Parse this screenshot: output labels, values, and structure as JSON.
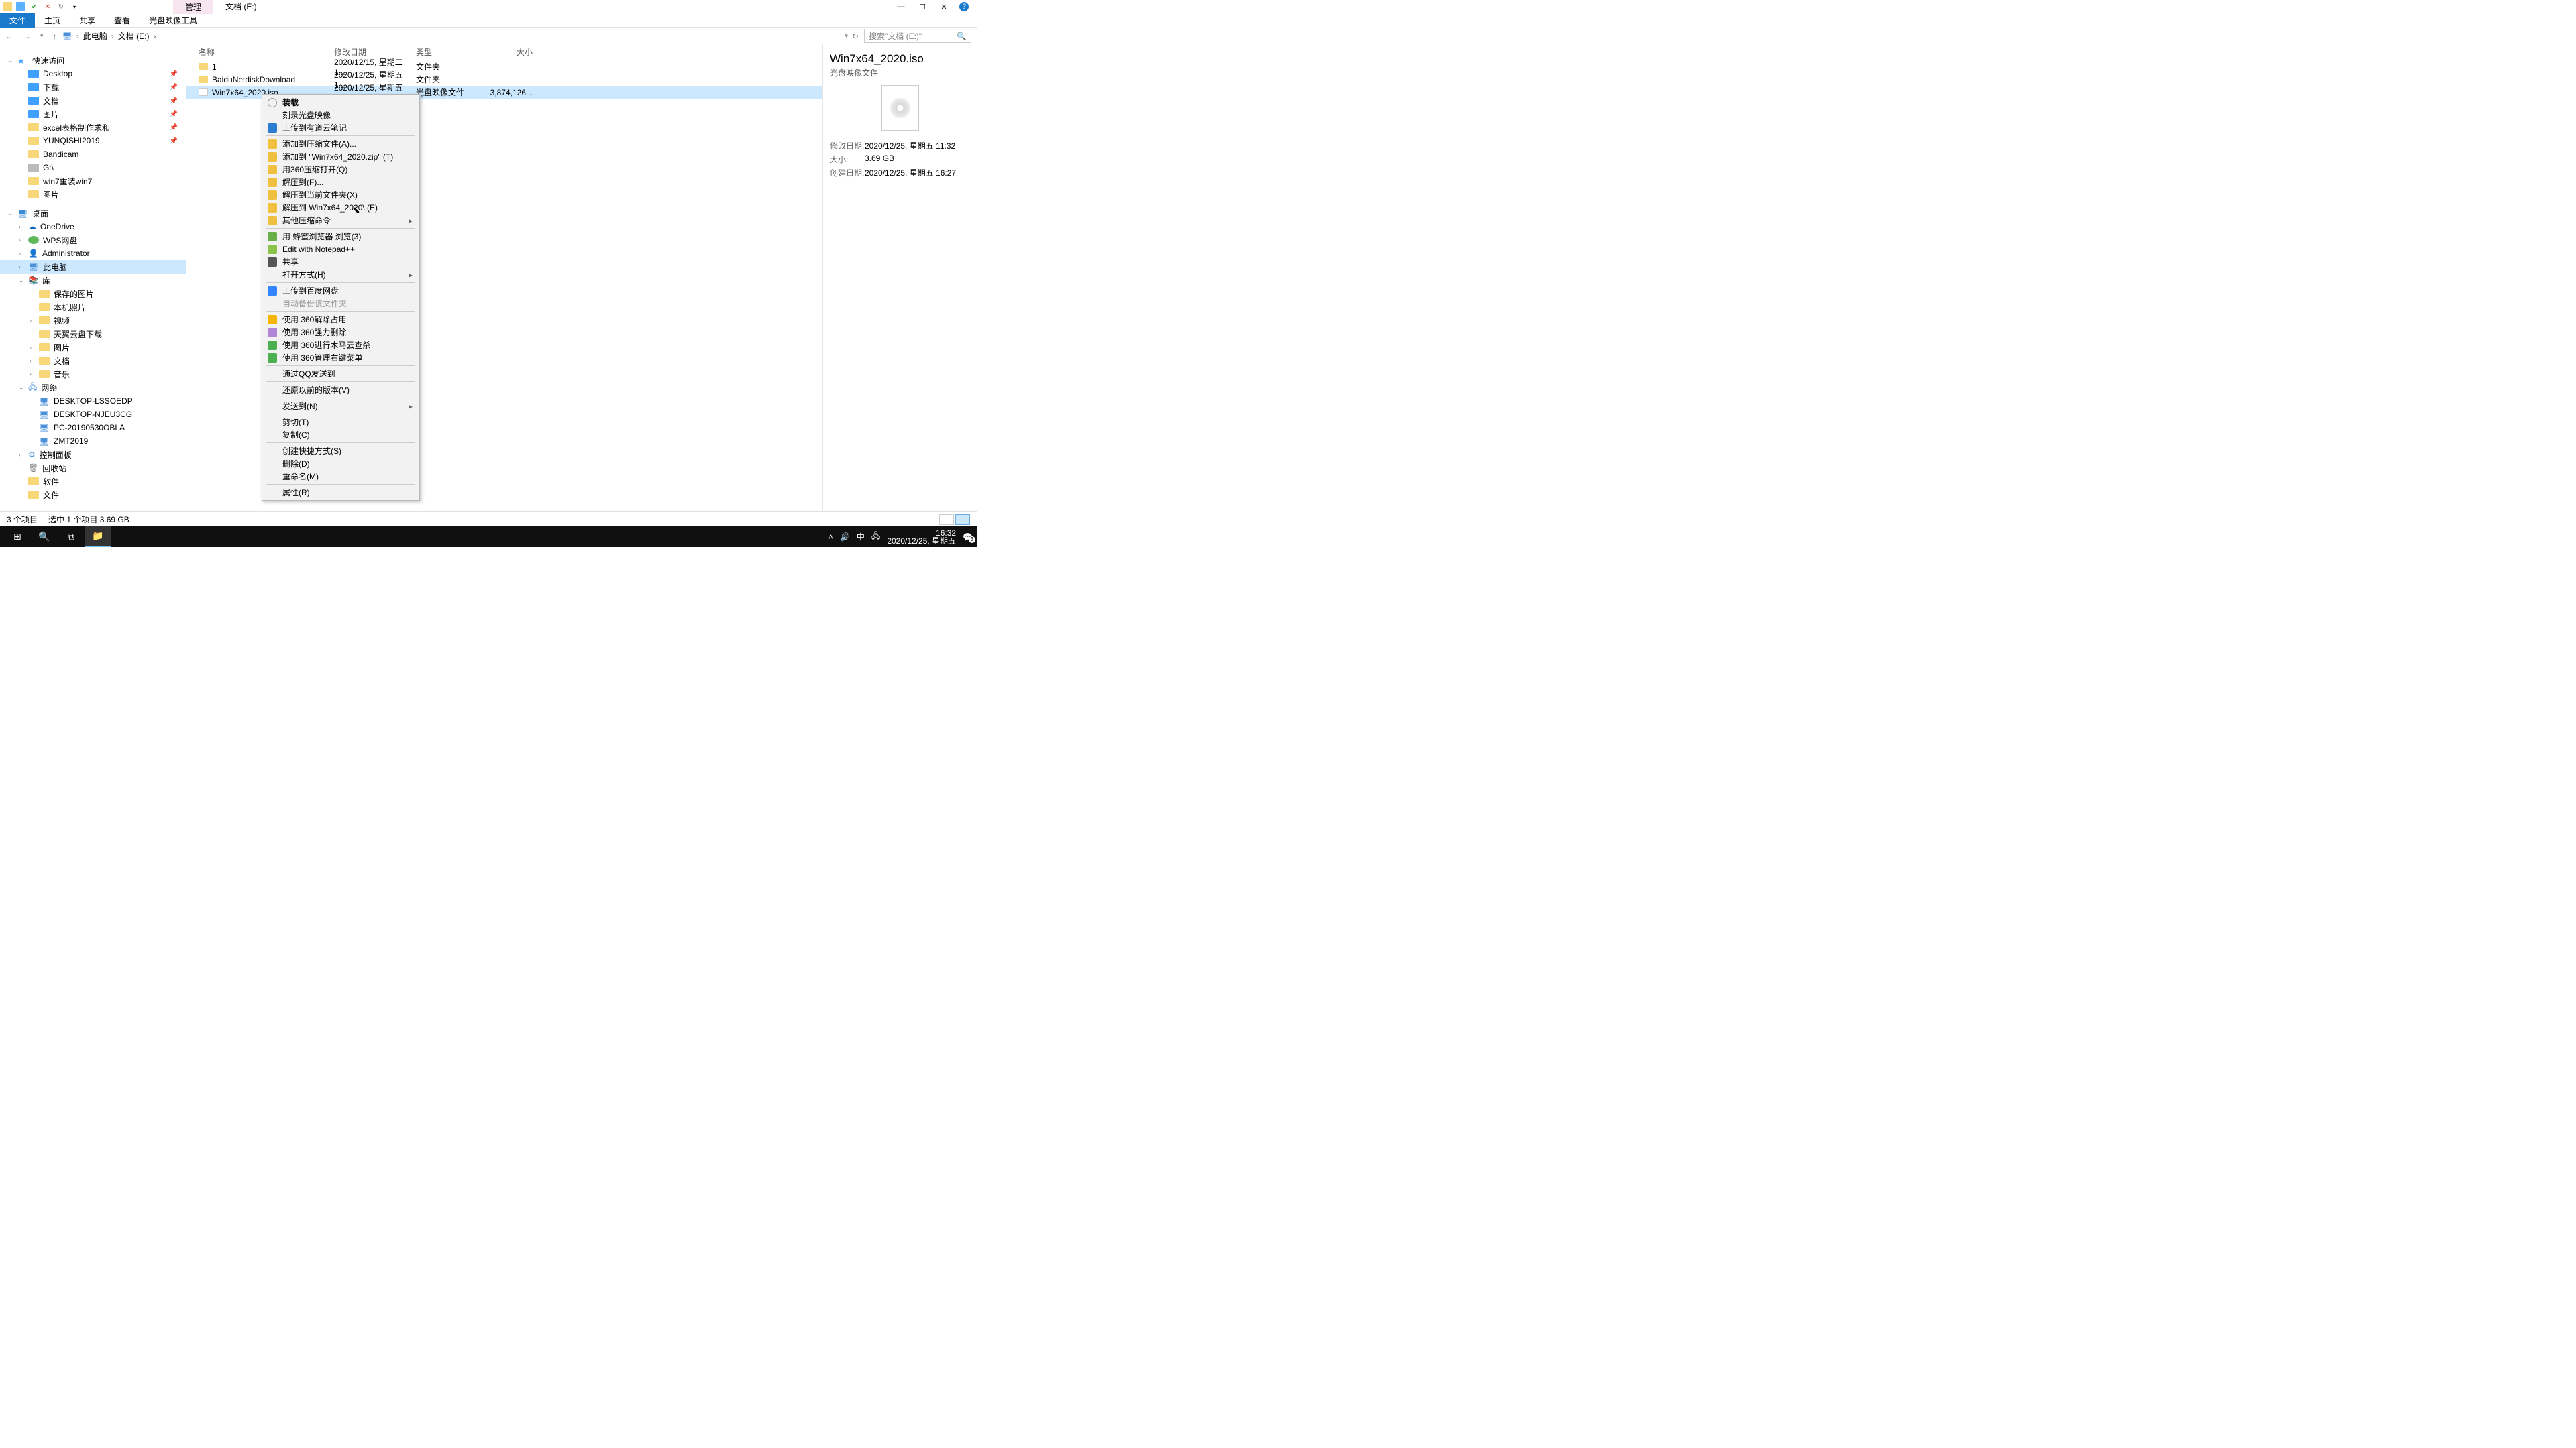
{
  "titlebar": {
    "tab_manage": "管理",
    "tab_loc": "文档 (E:)"
  },
  "winbtns": {
    "min": "—",
    "max": "☐",
    "close": "✕",
    "help": "?"
  },
  "ribbon": {
    "file": "文件",
    "home": "主页",
    "share": "共享",
    "view": "查看",
    "iso": "光盘映像工具"
  },
  "addr": {
    "pc": "此电脑",
    "loc": "文档 (E:)",
    "search_ph": "搜索\"文档 (E:)\""
  },
  "tree": {
    "quick": "快速访问",
    "desktop": "Desktop",
    "downloads": "下载",
    "documents": "文档",
    "pictures": "图片",
    "excel": "excel表格制作求和",
    "yunqi": "YUNQISHI2019",
    "bandicam": "Bandicam",
    "gdrive": "G:\\",
    "win7": "win7重装win7",
    "pic2": "图片",
    "desk": "桌面",
    "onedrive": "OneDrive",
    "wps": "WPS网盘",
    "admin": "Administrator",
    "thispc": "此电脑",
    "lib": "库",
    "saved": "保存的图片",
    "cam": "本机照片",
    "video": "视频",
    "ty": "天翼云盘下载",
    "pic3": "图片",
    "doc2": "文档",
    "music": "音乐",
    "net": "网络",
    "pc1": "DESKTOP-LSSOEDP",
    "pc2": "DESKTOP-NJEU3CG",
    "pc3": "PC-20190530OBLA",
    "pc4": "ZMT2019",
    "cp": "控制面板",
    "recycle": "回收站",
    "soft": "软件",
    "files": "文件"
  },
  "hdr": {
    "name": "名称",
    "date": "修改日期",
    "type": "类型",
    "size": "大小"
  },
  "rows": [
    {
      "name": "1",
      "date": "2020/12/15, 星期二 1...",
      "type": "文件夹",
      "size": ""
    },
    {
      "name": "BaiduNetdiskDownload",
      "date": "2020/12/25, 星期五 1...",
      "type": "文件夹",
      "size": ""
    },
    {
      "name": "Win7x64_2020.iso",
      "date": "2020/12/25, 星期五 1...",
      "type": "光盘映像文件",
      "size": "3,874,126..."
    }
  ],
  "ctx": [
    {
      "t": "装载",
      "b": true
    },
    {
      "t": "刻录光盘映像"
    },
    {
      "t": "上传到有道云笔记",
      "ic": "blue"
    },
    {
      "sep": true
    },
    {
      "t": "添加到压缩文件(A)...",
      "ic": "arch"
    },
    {
      "t": "添加到 \"Win7x64_2020.zip\" (T)",
      "ic": "arch"
    },
    {
      "t": "用360压缩打开(Q)",
      "ic": "arch"
    },
    {
      "t": "解压到(F)...",
      "ic": "arch"
    },
    {
      "t": "解压到当前文件夹(X)",
      "ic": "arch"
    },
    {
      "t": "解压到 Win7x64_2020\\ (E)",
      "ic": "arch"
    },
    {
      "t": "其他压缩命令",
      "ic": "arch",
      "sub": true
    },
    {
      "sep": true
    },
    {
      "t": "用 蜂蜜浏览器 浏览(3)",
      "ic": "gr"
    },
    {
      "t": "Edit with Notepad++",
      "ic": "np"
    },
    {
      "t": "共享",
      "ic": "share"
    },
    {
      "t": "打开方式(H)",
      "sub": true
    },
    {
      "sep": true
    },
    {
      "t": "上传到百度网盘",
      "ic": "bd"
    },
    {
      "t": "自动备份该文件夹",
      "dis": true
    },
    {
      "sep": true
    },
    {
      "t": "使用 360解除占用",
      "ic": "y"
    },
    {
      "t": "使用 360强力删除",
      "ic": "p"
    },
    {
      "t": "使用 360进行木马云查杀",
      "ic": "g360"
    },
    {
      "t": "使用 360管理右键菜单",
      "ic": "g360"
    },
    {
      "sep": true
    },
    {
      "t": "通过QQ发送到"
    },
    {
      "sep": true
    },
    {
      "t": "还原以前的版本(V)"
    },
    {
      "sep": true
    },
    {
      "t": "发送到(N)",
      "sub": true
    },
    {
      "sep": true
    },
    {
      "t": "剪切(T)"
    },
    {
      "t": "复制(C)"
    },
    {
      "sep": true
    },
    {
      "t": "创建快捷方式(S)"
    },
    {
      "t": "删除(D)"
    },
    {
      "t": "重命名(M)"
    },
    {
      "sep": true
    },
    {
      "t": "属性(R)"
    }
  ],
  "details": {
    "name": "Win7x64_2020.iso",
    "type": "光盘映像文件",
    "mdate_k": "修改日期:",
    "mdate": "2020/12/25, 星期五 11:32",
    "size_k": "大小:",
    "size": "3.69 GB",
    "cdate_k": "创建日期:",
    "cdate": "2020/12/25, 星期五 16:27"
  },
  "status": {
    "count": "3 个项目",
    "sel": "选中 1 个项目  3.69 GB"
  },
  "taskbar": {
    "time": "16:32",
    "date": "2020/12/25, 星期五",
    "ime": "中",
    "notif": "3"
  }
}
